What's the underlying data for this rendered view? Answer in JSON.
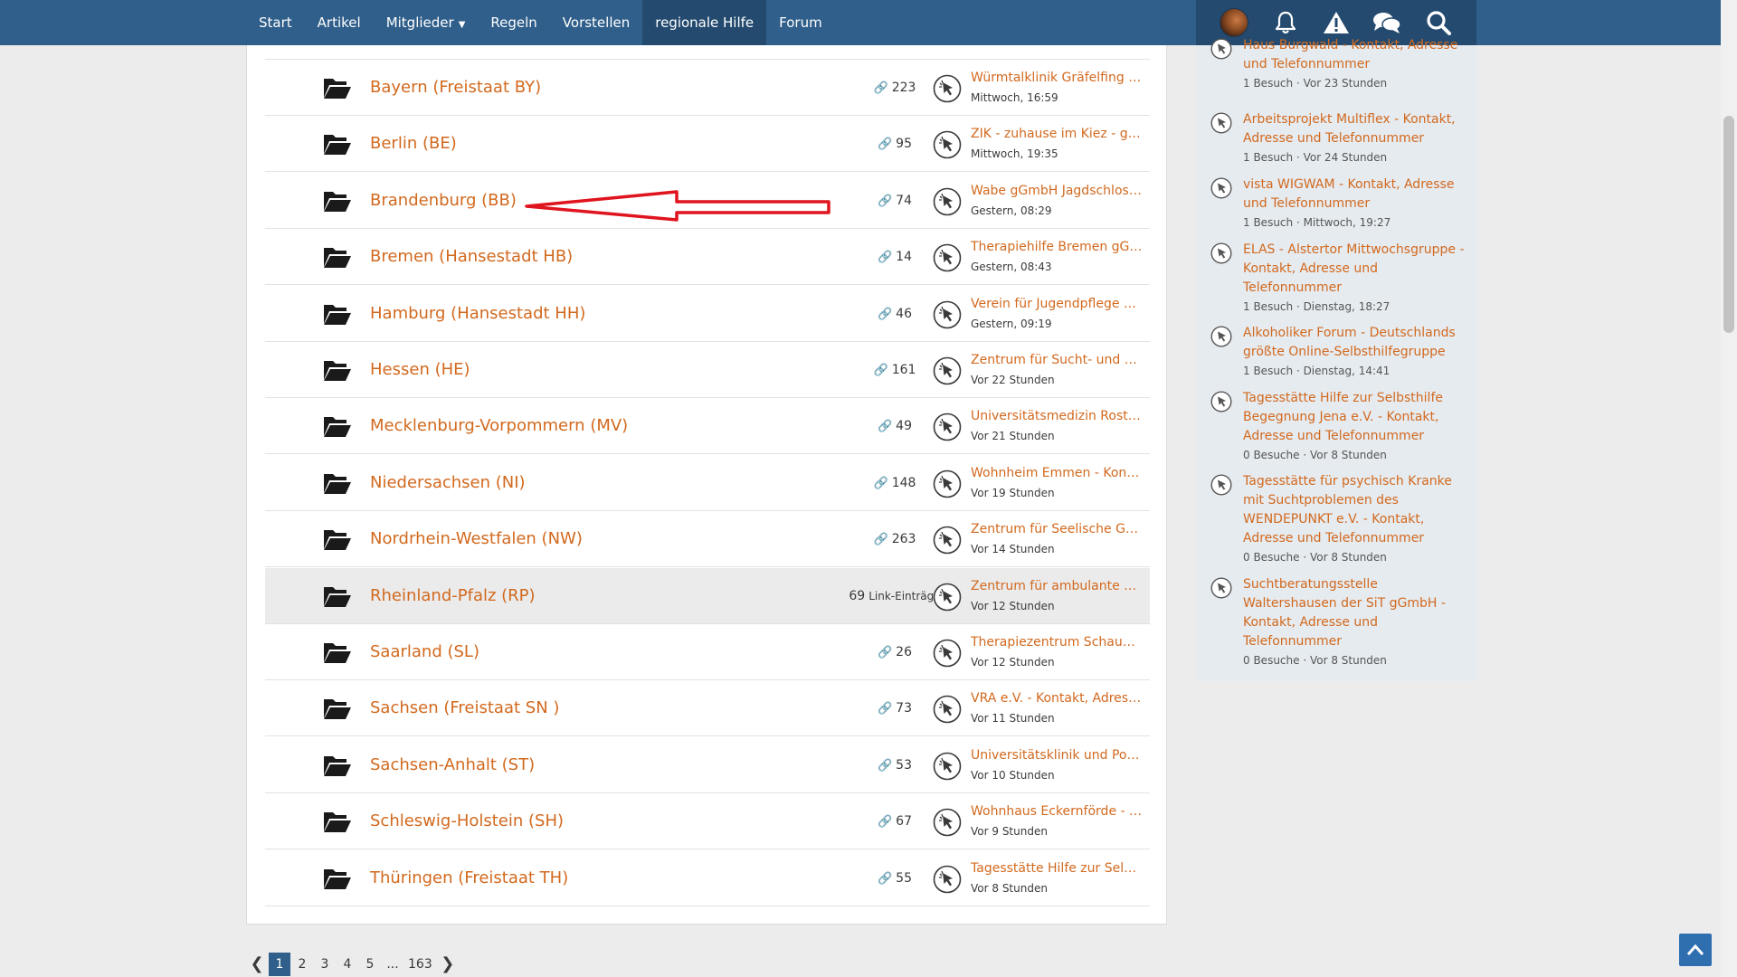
{
  "nav": {
    "items": [
      {
        "label": "Start"
      },
      {
        "label": "Artikel"
      },
      {
        "label": "Mitglieder"
      },
      {
        "label": "Regeln"
      },
      {
        "label": "Vorstellen"
      },
      {
        "label": "regionale Hilfe"
      },
      {
        "label": "Forum"
      }
    ],
    "active_item": "regionale Hilfe",
    "right_icons": [
      "avatar",
      "bell-icon",
      "warning-icon",
      "chat-bubbles-icon",
      "search-icon"
    ]
  },
  "categories": [
    {
      "title": "Bayern (Freistaat BY)",
      "count": "223",
      "last_title": "Würmtalklinik Gräfelfing - ...",
      "last_time": "Mittwoch, 16:59"
    },
    {
      "title": "Berlin (BE)",
      "count": "95",
      "last_title": "ZIK - zuhause im Kiez - gG...",
      "last_time": "Mittwoch, 19:35"
    },
    {
      "title": "Brandenburg (BB)",
      "count": "74",
      "last_title": "Wabe gGmbH Jagdschloss ...",
      "last_time": "Gestern, 08:29"
    },
    {
      "title": "Bremen (Hansestadt HB)",
      "count": "14",
      "last_title": "Therapiehilfe Bremen gGm...",
      "last_time": "Gestern, 08:43"
    },
    {
      "title": "Hamburg (Hansestadt HH)",
      "count": "46",
      "last_title": "Verein für Jugendpflege e....",
      "last_time": "Gestern, 09:19"
    },
    {
      "title": "Hessen (HE)",
      "count": "161",
      "last_title": "Zentrum für Sucht- und So...",
      "last_time": "Vor 22 Stunden"
    },
    {
      "title": "Mecklenburg-Vorpommern (MV)",
      "count": "49",
      "last_title": "Universitätsmedizin Rostoc...",
      "last_time": "Vor 21 Stunden"
    },
    {
      "title": "Niedersachsen (NI)",
      "count": "148",
      "last_title": "Wohnheim Emmen - Konta...",
      "last_time": "Vor 19 Stunden"
    },
    {
      "title": "Nordrhein-Westfalen (NW)",
      "count": "263",
      "last_title": "Zentrum für Seelische Ges...",
      "last_time": "Vor 14 Stunden"
    },
    {
      "title": "Rheinland-Pfalz (RP)",
      "count": "69",
      "count_suffix": "Link-Einträge",
      "last_title": "Zentrum für ambulante Su...",
      "last_time": "Vor 12 Stunden"
    },
    {
      "title": "Saarland (SL)",
      "count": "26",
      "last_title": "Therapiezentrum Schaum...",
      "last_time": "Vor 12 Stunden"
    },
    {
      "title": "Sachsen (Freistaat SN )",
      "count": "73",
      "last_title": "VRA e.V. - Kontakt, Adresse...",
      "last_time": "Vor 11 Stunden"
    },
    {
      "title": "Sachsen-Anhalt (ST)",
      "count": "53",
      "last_title": "Universitätsklinik und Polik...",
      "last_time": "Vor 10 Stunden"
    },
    {
      "title": "Schleswig-Holstein (SH)",
      "count": "67",
      "last_title": "Wohnhaus Eckernförde - K...",
      "last_time": "Vor 9 Stunden"
    },
    {
      "title": "Thüringen (Freistaat TH)",
      "count": "55",
      "last_title": "Tagesstätte Hilfe zur Selbst...",
      "last_time": "Vor 8 Stunden"
    }
  ],
  "pagination": {
    "pages": [
      "1",
      "2",
      "3",
      "4",
      "5",
      "...",
      "163"
    ],
    "current": "1"
  },
  "sidebar": {
    "items": [
      {
        "title": "Haus Burgwald - Kontakt, Adresse und Telefonnummer",
        "meta": "1 Besuch · Vor 23 Stunden"
      },
      {
        "title": "Arbeitsprojekt Multiflex - Kontakt, Adresse und Telefonnummer",
        "meta": "1 Besuch · Vor 24 Stunden"
      },
      {
        "title": "vista WIGWAM - Kontakt, Adresse und Telefonnummer",
        "meta": "1 Besuch · Mittwoch, 19:27"
      },
      {
        "title": "ELAS - Alstertor Mittwochsgruppe - Kontakt, Adresse und Telefonnummer",
        "meta": "1 Besuch · Dienstag, 18:27"
      },
      {
        "title": "Alkoholiker Forum - Deutschlands größte Online-Selbsthilfegruppe",
        "meta": "1 Besuch · Dienstag, 14:41"
      },
      {
        "title": "Tagesstätte Hilfe zur Selbsthilfe Begegnung Jena e.V. - Kontakt, Adresse und Telefonnummer",
        "meta": "0 Besuche · Vor 8 Stunden"
      },
      {
        "title": "Tagesstätte für psychisch Kranke mit Suchtproblemen des WENDEPUNKT e.V. - Kontakt, Adresse und Telefonnummer",
        "meta": "0 Besuche · Vor 8 Stunden"
      },
      {
        "title": "Suchtberatungsstelle Waltershausen der SiT gGmbH - Kontakt, Adresse und Telefonnummer",
        "meta": "0 Besuche · Vor 8 Stunden"
      }
    ]
  },
  "colors": {
    "nav_bg": "#2f5f8a",
    "nav_active": "#244b6f",
    "link": "#d2691e",
    "annotation_arrow": "#e0141e",
    "sidebar_bg": "#e6ebf0"
  }
}
